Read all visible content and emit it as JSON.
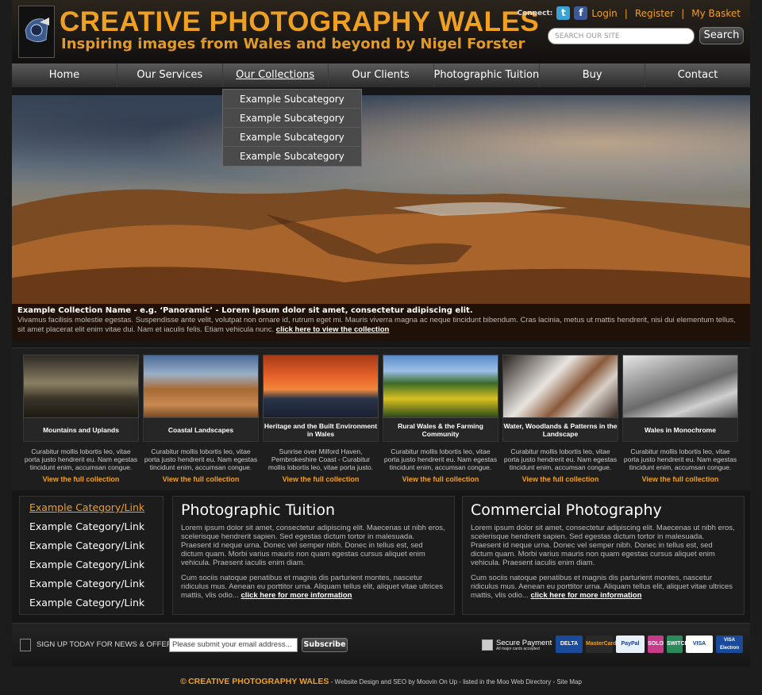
{
  "header": {
    "title": "CREATIVE PHOTOGRAPHY WALES",
    "tagline": "Inspiring images from Wales and beyond by Nigel Forster",
    "connect_label": "Connect:",
    "login": "Login",
    "register": "Register",
    "basket": "My Basket",
    "search_placeholder": "SEARCH OUR SITE",
    "search_button": "Search"
  },
  "nav": {
    "items": [
      "Home",
      "Our Services",
      "Our Collections",
      "Our Clients",
      "Photographic Tuition",
      "Buy",
      "Contact"
    ],
    "active": "Our Collections",
    "dropdown": [
      "Example Subcategory",
      "Example Subcategory",
      "Example Subcategory",
      "Example Subcategory"
    ]
  },
  "hero": {
    "caption_title": "Example Collection Name - e.g. ‘Panoramic’ - Lorem ipsum dolor sit amet, consectetur adipiscing elit.",
    "caption_text": "Vivamus facilisis molestie egestas. Suspendisse ante velit, volutpat non ornare id, rutrum eget mi. Mauris viverra magna ac neque tincidunt bibendum. Cras lacinia, metus ut mattis hendrerit, nisi dui elementum tellus, sit amet placerat elit enim vitae dui. Nam et iaculis felis. Etiam vehicula nunc.",
    "caption_link": "click here to view the collection"
  },
  "collections": [
    {
      "title": "Mountains and Uplands",
      "desc": "Curabitur mollis lobortis leo, vitae porta justo hendrerit eu. Nam egestas tincidunt enim, accumsan congue.",
      "link": "View the full collection"
    },
    {
      "title": "Coastal Landscapes",
      "desc": "Curabitur mollis lobortis leo, vitae porta justo hendrerit eu. Nam egestas tincidunt enim, accumsan congue.",
      "link": "View the full collection"
    },
    {
      "title": "Heritage and the Built Environment in Wales",
      "desc": "Sunrise over Milford Haven, Pembrokeshire Coast - Curabitur mollis lobortis leo, vitae porta justo.",
      "link": "View the full collection"
    },
    {
      "title": "Rural Wales & the Farming Community",
      "desc": "Curabitur mollis lobortis leo, vitae porta justo hendrerit eu. Nam egestas tincidunt enim, accumsan congue.",
      "link": "View the full collection"
    },
    {
      "title": "Water, Woodlands & Patterns in the Landscape",
      "desc": "Curabitur mollis lobortis leo, vitae porta justo hendrerit eu. Nam egestas tincidunt enim, accumsan congue.",
      "link": "View the full collection"
    },
    {
      "title": "Wales in Monochrome",
      "desc": "Curabitur mollis lobortis leo, vitae porta justo hendrerit eu. Nam egestas tincidunt enim, accumsan congue.",
      "link": "View the full collection"
    }
  ],
  "categories": [
    "Example Category/Link",
    "Example Category/Link",
    "Example Category/Link",
    "Example Category/Link",
    "Example Category/Link",
    "Example Category/Link"
  ],
  "tuition": {
    "heading": "Photographic Tuition",
    "p1": "Lorem ipsum dolor sit amet, consectetur adipiscing elit. Maecenas ut nibh eros, scelerisque hendrerit sapien. Sed egestas dictum tortor in malesuada. Praesent id neque urna. Donec vel semper nibh. Donec in tellus est, sed dictum quam. Morbi varius mauris non quam egestas cursus aliquet enim vehicula. Praesent iaculis enim diam.",
    "p2": "Cum sociis natoque penatibus et magnis dis parturient montes, nascetur ridiculus mus. Aenean eu porttitor urna. Aliquam tellus elit, aliquet vitae ultrices mattis, vlis odio...",
    "more": "click here for more information"
  },
  "commercial": {
    "heading": "Commercial Photography",
    "p1": "Lorem ipsum dolor sit amet, consectetur adipiscing elit. Maecenas ut nibh eros, scelerisque hendrerit sapien. Sed egestas dictum tortor in malesuada. Praesent id neque urna. Donec vel semper nibh. Donec in tellus est, sed dictum quam. Morbi varius mauris non quam egestas cursus aliquet enim vehicula. Praesent iaculis enim diam.",
    "p2": "Cum sociis natoque penatibus et magnis dis parturient montes, nascetur ridiculus mus. Aenean eu porttitor urna. Aliquam tellus elit, aliquet vitae ultrices mattis, vlis odio...",
    "more": "click here for more information"
  },
  "signup": {
    "label": "SIGN UP TODAY FOR NEWS & OFFERS",
    "email_placeholder": "Please submit your email address...",
    "button": "Subscribe"
  },
  "payment": {
    "title": "Secure Payment",
    "subtitle": "All major cards accepted",
    "cards": [
      "DELTA",
      "MasterCard",
      "PayPal",
      "SOLO",
      "SWITCH",
      "VISA",
      "VISA Electron"
    ]
  },
  "footer": {
    "copyright_symbol": "©",
    "brand": "CREATIVE PHOTOGRAPHY WALES",
    "text": " - Website Design and SEO by Moovin On Up - listed in the Moo Web Directory - Site Map"
  },
  "colors": {
    "accent": "#f0a020",
    "background": "#1c1c1c",
    "nav": "#3c3c3c"
  }
}
